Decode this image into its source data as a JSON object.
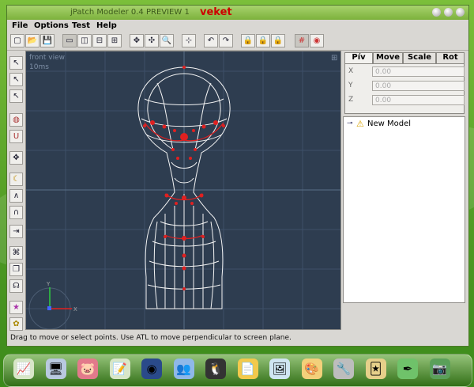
{
  "window": {
    "title": "jPatch Modeler 0.4 PREVIEW 1",
    "user": "veket"
  },
  "menu": [
    "File",
    "Options",
    "Test",
    "Help"
  ],
  "toolbar": [
    {
      "icon": "new-icon",
      "glyph": "▢"
    },
    {
      "icon": "open-icon",
      "glyph": "📂"
    },
    {
      "icon": "save-icon",
      "glyph": "💾"
    },
    {
      "icon": "single-view-icon",
      "glyph": "▭"
    },
    {
      "icon": "split-vertical-icon",
      "glyph": "◫"
    },
    {
      "icon": "split-horizontal-icon",
      "glyph": "⊟"
    },
    {
      "icon": "quad-view-icon",
      "glyph": "⊞"
    },
    {
      "icon": "move-view-icon",
      "glyph": "✥"
    },
    {
      "icon": "rotate-view-icon",
      "glyph": "✣"
    },
    {
      "icon": "zoom-icon",
      "glyph": "🔍"
    },
    {
      "icon": "center-view-icon",
      "glyph": "⊹"
    },
    {
      "icon": "undo-icon",
      "glyph": "↶"
    },
    {
      "icon": "redo-icon",
      "glyph": "↷"
    },
    {
      "icon": "lock-points-icon",
      "glyph": "🔒"
    },
    {
      "icon": "lock-x-icon",
      "glyph": "🔒"
    },
    {
      "icon": "lock-y-icon",
      "glyph": "🔒"
    },
    {
      "icon": "grid-snap-icon",
      "glyph": "#"
    },
    {
      "icon": "rotoscope-icon",
      "glyph": "◉"
    }
  ],
  "left_tools": [
    {
      "icon": "select-icon",
      "glyph": "↖"
    },
    {
      "icon": "add-point-icon",
      "glyph": "↖"
    },
    {
      "icon": "add-curve-icon",
      "glyph": "↖"
    },
    {
      "icon": "lathe-icon",
      "glyph": "◍"
    },
    {
      "icon": "magnet-icon",
      "glyph": "U"
    },
    {
      "icon": "move-icon",
      "glyph": "✥"
    },
    {
      "icon": "bend-icon",
      "glyph": "☾"
    },
    {
      "icon": "peak-icon",
      "glyph": "∧"
    },
    {
      "icon": "round-icon",
      "glyph": "∩"
    },
    {
      "icon": "extrude-icon",
      "glyph": "⇥"
    },
    {
      "icon": "weld-icon",
      "glyph": "⌘"
    },
    {
      "icon": "clone-icon",
      "glyph": "❐"
    },
    {
      "icon": "morph-icon",
      "glyph": "☊"
    },
    {
      "icon": "star-icon",
      "glyph": "★"
    },
    {
      "icon": "palette-icon",
      "glyph": "✿"
    }
  ],
  "viewport": {
    "view_name": "front view",
    "scale": "10ms"
  },
  "panel": {
    "tabs": [
      "Pív",
      "Move",
      "Scale",
      "Rot"
    ],
    "fields": [
      {
        "label": "X",
        "value": "0.00"
      },
      {
        "label": "Y",
        "value": "0.00"
      },
      {
        "label": "Z",
        "value": "0.00"
      }
    ],
    "tree_item": "New Model"
  },
  "status": "Drag to move or select points. Use ATL to move perpendicular to screen plane.",
  "dock": [
    {
      "icon": "chart-icon",
      "glyph": "📈",
      "color": "#d8e6c8"
    },
    {
      "icon": "monitor-icon",
      "glyph": "🖥",
      "color": "#b9c9e0"
    },
    {
      "icon": "pig-icon",
      "glyph": "🐷",
      "color": "#e27a8b"
    },
    {
      "icon": "notes-icon",
      "glyph": "📝",
      "color": "#d8e6c8"
    },
    {
      "icon": "quicktime-icon",
      "glyph": "◉",
      "color": "#2a4a8a"
    },
    {
      "icon": "users-icon",
      "glyph": "👥",
      "color": "#8fb8e8"
    },
    {
      "icon": "penguin-icon",
      "glyph": "🐧",
      "color": "#333333"
    },
    {
      "icon": "document-icon",
      "glyph": "📄",
      "color": "#f2c94c"
    },
    {
      "icon": "image-viewer-icon",
      "glyph": "🖼",
      "color": "#d0e6f2"
    },
    {
      "icon": "paint-icon",
      "glyph": "🎨",
      "color": "#f3d07a"
    },
    {
      "icon": "tool-icon",
      "glyph": "🔧",
      "color": "#bdbdbd"
    },
    {
      "icon": "card-icon",
      "glyph": "🃏",
      "color": "#e6d08a"
    },
    {
      "icon": "script-icon",
      "glyph": "✒",
      "color": "#6fc26a"
    },
    {
      "icon": "camera-icon",
      "glyph": "📷",
      "color": "#5aa05a"
    }
  ]
}
